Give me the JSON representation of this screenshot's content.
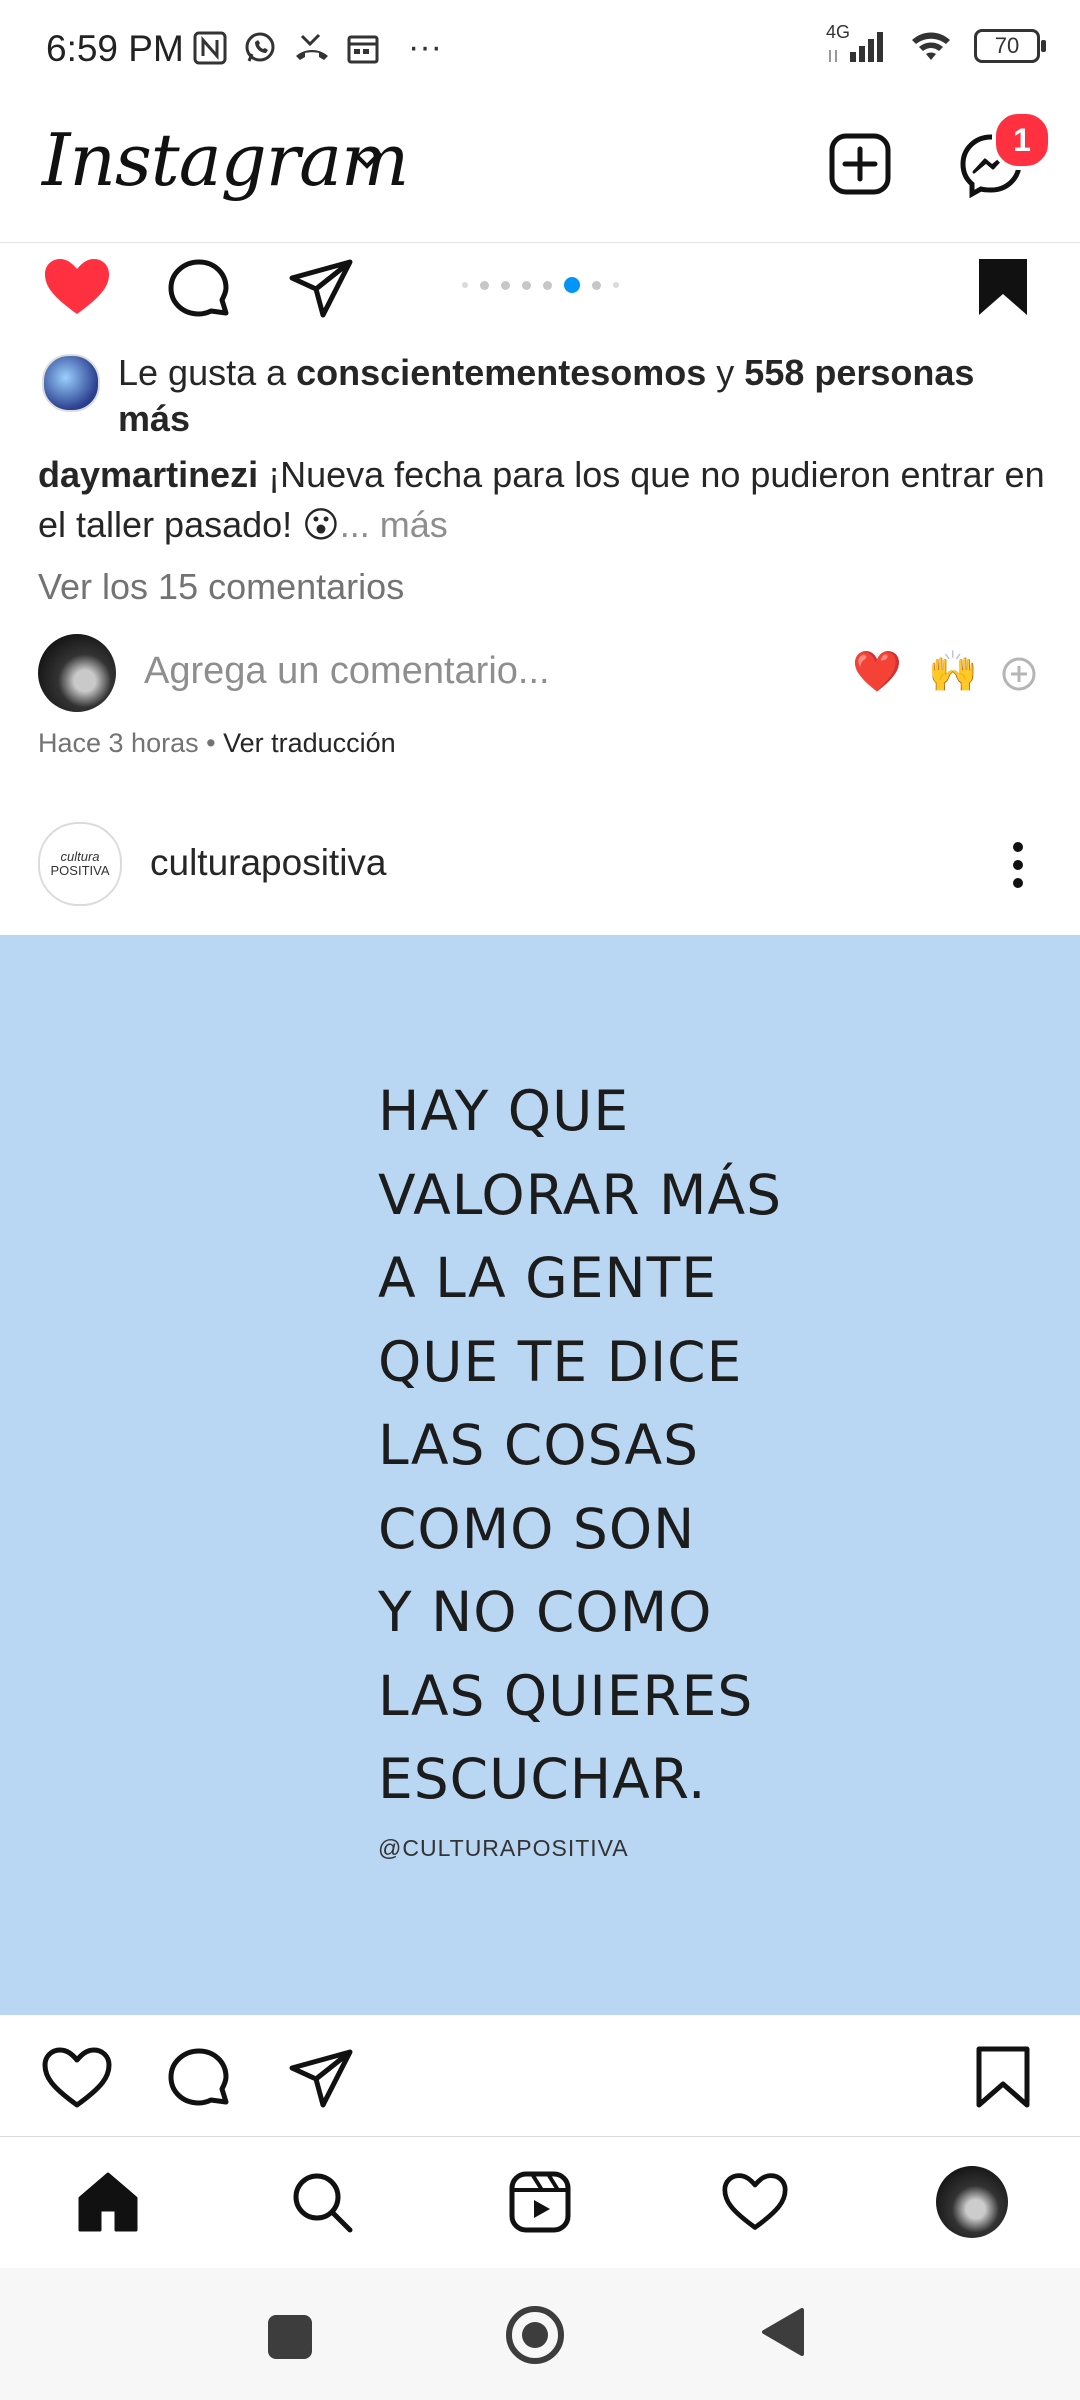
{
  "status_bar": {
    "time": "6:59 PM",
    "network": "4G",
    "battery": "70",
    "more": "···"
  },
  "header": {
    "logo": "Instagram",
    "messenger_badge": "1"
  },
  "post1": {
    "carousel": {
      "count": 8,
      "active_index": 5
    },
    "likes": {
      "prefix": "Le gusta a ",
      "user": "conscientementesomos",
      "joiner": " y ",
      "others": "558 personas más"
    },
    "caption": {
      "username": "daymartinezi",
      "text": " ¡Nueva fecha para los que no pudieron entrar en el taller pasado! 😮",
      "more": "... más"
    },
    "comments_link": "Ver los 15 comentarios",
    "comment_placeholder": "Agrega un comentario...",
    "quick_reactions": [
      "❤️",
      "🙌"
    ],
    "time_ago": "Hace 3 horas",
    "translate": "Ver traducción"
  },
  "post2": {
    "username": "culturapositiva",
    "avatar_text_top": "cultura",
    "avatar_text_bottom": "POSITIVA",
    "image_bg": "#b9d6f2",
    "quote_lines": [
      "HAY QUE",
      "VALORAR MÁS",
      "A LA GENTE",
      "QUE TE DICE",
      "LAS COSAS",
      "COMO SON",
      "Y NO COMO",
      "LAS QUIERES",
      "ESCUCHAR."
    ],
    "watermark": "@CULTURAPOSITIVA"
  },
  "colors": {
    "like_red": "#ff3040",
    "accent_blue": "#0095f6"
  },
  "icons": {
    "nav": [
      "home-icon",
      "search-icon",
      "reels-icon",
      "activity-heart-icon",
      "profile-avatar"
    ],
    "system": [
      "recents-square-icon",
      "home-circle-icon",
      "back-triangle-icon"
    ]
  }
}
